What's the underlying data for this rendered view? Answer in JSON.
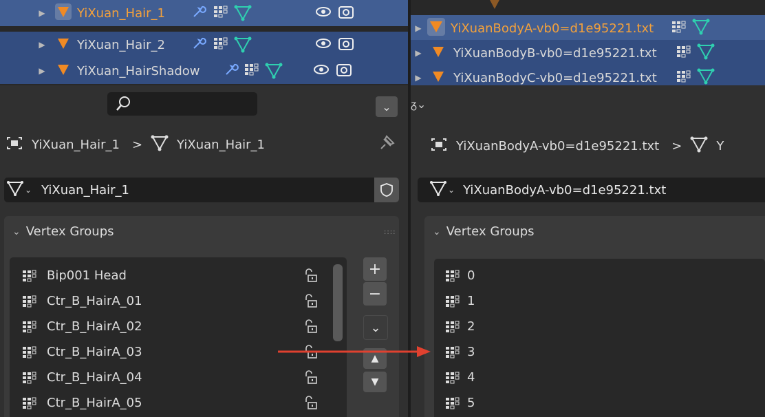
{
  "left": {
    "outliner": [
      {
        "name": "YiXuan_Hair_1",
        "active": true
      },
      {
        "name": "YiXuan_Hair_2",
        "active": false
      },
      {
        "name": "YiXuan_HairShadow",
        "active": false
      }
    ],
    "breadcrumb": {
      "object": "YiXuan_Hair_1",
      "separator": ">",
      "mesh": "YiXuan_Hair_1"
    },
    "datablock_name": "YiXuan_Hair_1",
    "vertex_groups": {
      "header": "Vertex Groups",
      "items": [
        "Bip001 Head",
        "Ctr_B_HairA_01",
        "Ctr_B_HairA_02",
        "Ctr_B_HairA_03",
        "Ctr_B_HairA_04",
        "Ctr_B_HairA_05"
      ]
    },
    "buttons": {
      "add": "+",
      "remove": "−"
    }
  },
  "right": {
    "outliner": [
      {
        "name": "YiXuanBodyA-vb0=d1e95221.txt",
        "active": true
      },
      {
        "name": "YiXuanBodyB-vb0=d1e95221.txt",
        "active": false
      },
      {
        "name": "YiXuanBodyC-vb0=d1e95221.txt",
        "active": false
      }
    ],
    "breadcrumb": {
      "object": "YiXuanBodyA-vb0=d1e95221.txt",
      "separator": ">",
      "mesh": "Y"
    },
    "datablock_name": "YiXuanBodyA-vb0=d1e95221.txt",
    "vertex_groups": {
      "header": "Vertex Groups",
      "items": [
        "0",
        "1",
        "2",
        "3",
        "4",
        "5"
      ]
    }
  },
  "colors": {
    "selected_text": "#f4a13b",
    "row_active": "#415e93",
    "row_selected": "#334d80",
    "mesh_icon": "#2fd0b0",
    "annotation_arrow": "#e0412f"
  }
}
